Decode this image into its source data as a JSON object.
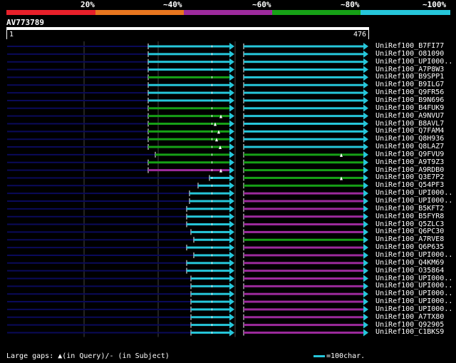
{
  "legend": {
    "labels": [
      "20%",
      "~40%",
      "~60%",
      "~80%",
      "~100%"
    ],
    "colors": [
      "#e8202a",
      "#e8761f",
      "#9c2a9c",
      "#16a016",
      "#26c6da"
    ]
  },
  "query": {
    "id": "AV773789",
    "start": "1",
    "end": "476"
  },
  "colors": {
    "cyan": "#26c6da",
    "green": "#16a016",
    "purple": "#9c2a9c",
    "navy": "#0a0a5a",
    "grid": "#444444"
  },
  "hits": [
    {
      "label": "UniRef100_B7FI77",
      "c1": "cyan",
      "c2": "cyan"
    },
    {
      "label": "UniRef100_O81090",
      "c1": "cyan",
      "c2": "cyan"
    },
    {
      "label": "UniRef100_UPI000..",
      "c1": "cyan",
      "c2": "cyan"
    },
    {
      "label": "UniRef100_A7P8W3",
      "c1": "cyan",
      "c2": "cyan"
    },
    {
      "label": "UniRef100_B9SPP1",
      "c1": "green",
      "c2": "cyan"
    },
    {
      "label": "UniRef100_B9ILG7",
      "c1": "cyan",
      "c2": "cyan"
    },
    {
      "label": "UniRef100_Q9FR56",
      "c1": "cyan",
      "c2": "cyan"
    },
    {
      "label": "UniRef100_B9N696",
      "c1": "cyan",
      "c2": "cyan"
    },
    {
      "label": "UniRef100_B4FUK9",
      "c1": "green",
      "c2": "cyan"
    },
    {
      "label": "UniRef100_A9NVU7",
      "c1": "green",
      "c2": "cyan"
    },
    {
      "label": "UniRef100_B8AVL7",
      "c1": "green",
      "c2": "cyan"
    },
    {
      "label": "UniRef100_Q7FAM4",
      "c1": "green",
      "c2": "cyan"
    },
    {
      "label": "UniRef100_Q8H936",
      "c1": "green",
      "c2": "cyan"
    },
    {
      "label": "UniRef100_Q8LAZ7",
      "c1": "green",
      "c2": "cyan"
    },
    {
      "label": "UniRef100_Q9FVU9",
      "c1": "green",
      "c2": "green"
    },
    {
      "label": "UniRef100_A9T9Z3",
      "c1": "green",
      "c2": "green"
    },
    {
      "label": "UniRef100_A9RDB0",
      "c1": "purple",
      "c2": "green"
    },
    {
      "label": "UniRef100_Q3E7P2",
      "c1": "cyan",
      "c2": "green"
    },
    {
      "label": "UniRef100_Q54PF3",
      "c1": "cyan",
      "c2": "green"
    },
    {
      "label": "UniRef100_UPI000..",
      "c1": "cyan",
      "c2": "purple"
    },
    {
      "label": "UniRef100_UPI000..",
      "c1": "cyan",
      "c2": "purple"
    },
    {
      "label": "UniRef100_B5KFT2",
      "c1": "cyan",
      "c2": "purple"
    },
    {
      "label": "UniRef100_B5FYR8",
      "c1": "cyan",
      "c2": "purple"
    },
    {
      "label": "UniRef100_Q5ZLC3",
      "c1": "cyan",
      "c2": "purple"
    },
    {
      "label": "UniRef100_Q6PC30",
      "c1": "cyan",
      "c2": "purple"
    },
    {
      "label": "UniRef100_A7RVE8",
      "c1": "cyan",
      "c2": "green"
    },
    {
      "label": "UniRef100_Q6P635",
      "c1": "cyan",
      "c2": "purple"
    },
    {
      "label": "UniRef100_UPI000..",
      "c1": "cyan",
      "c2": "purple"
    },
    {
      "label": "UniRef100_Q4KM69",
      "c1": "cyan",
      "c2": "purple"
    },
    {
      "label": "UniRef100_O35864",
      "c1": "cyan",
      "c2": "purple"
    },
    {
      "label": "UniRef100_UPI000..",
      "c1": "cyan",
      "c2": "purple"
    },
    {
      "label": "UniRef100_UPI000..",
      "c1": "cyan",
      "c2": "purple"
    },
    {
      "label": "UniRef100_UPI000..",
      "c1": "cyan",
      "c2": "purple"
    },
    {
      "label": "UniRef100_UPI000..",
      "c1": "cyan",
      "c2": "purple"
    },
    {
      "label": "UniRef100_UPI000..",
      "c1": "cyan",
      "c2": "purple"
    },
    {
      "label": "UniRef100_A7TX80",
      "c1": "cyan",
      "c2": "purple"
    },
    {
      "label": "UniRef100_Q92905",
      "c1": "cyan",
      "c2": "purple"
    },
    {
      "label": "UniRef100_C1BKS9",
      "c1": "cyan",
      "c2": "purple"
    }
  ],
  "footer": {
    "gaps_text": "Large gaps: ▲(in Query)/- (in Subject)",
    "scale_text": "=100char."
  }
}
